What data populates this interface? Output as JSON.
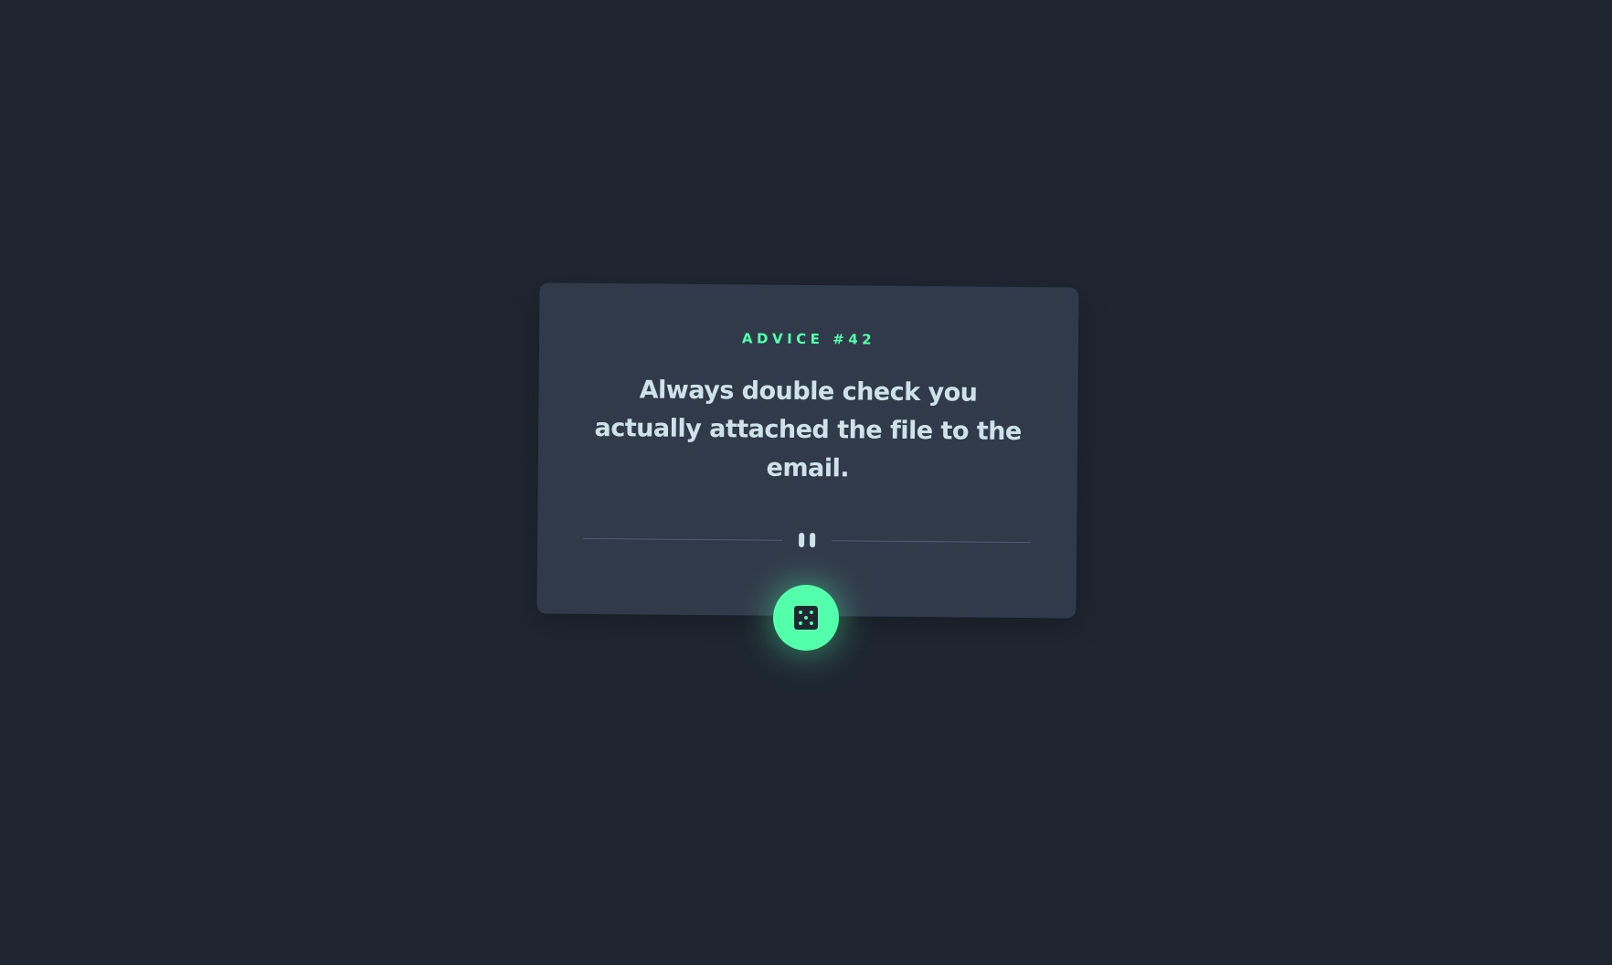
{
  "card": {
    "label": "ADVICE #42",
    "advice": "Always double check you actually attached the file to the email."
  },
  "icons": {
    "divider": "pause-icon",
    "button": "dice-icon"
  },
  "colors": {
    "background": "#1f2631",
    "card": "#313a4a",
    "accent": "#53ffab",
    "text": "#cee3e9",
    "divider": "#4f5d74"
  }
}
